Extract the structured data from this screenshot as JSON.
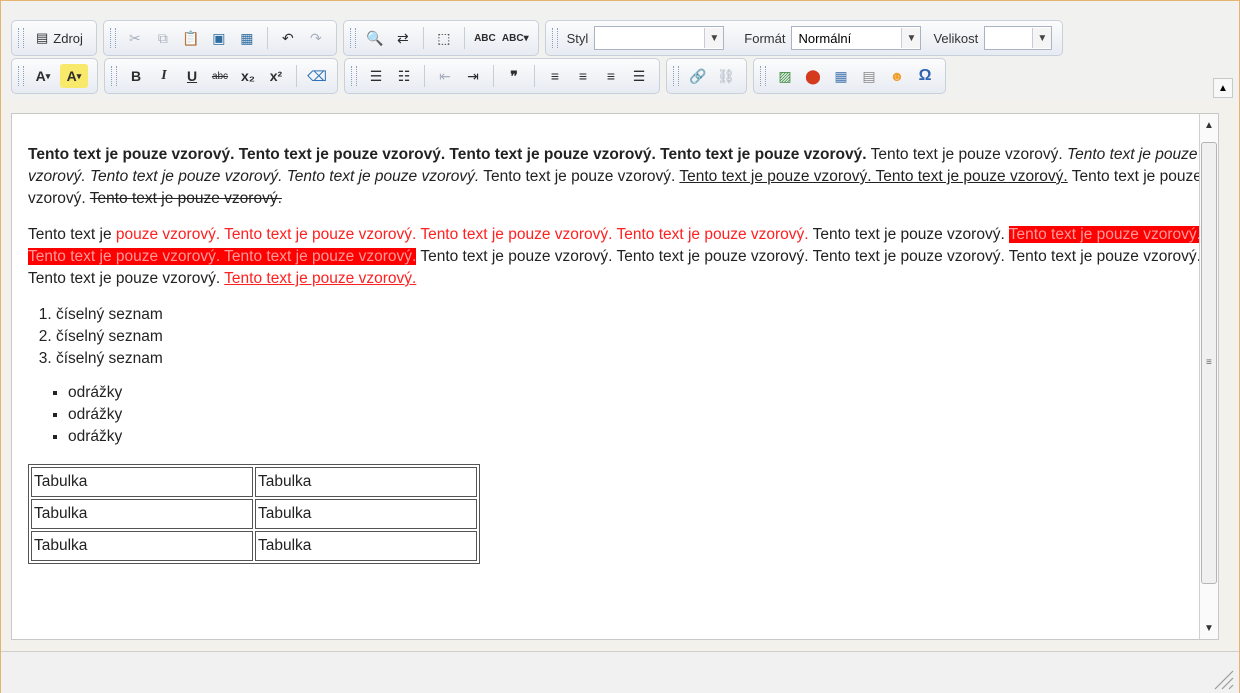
{
  "toolbar": {
    "source_label": "Zdroj",
    "style_label": "Styl",
    "style_value": "",
    "format_label": "Formát",
    "format_value": "Normální",
    "size_label": "Velikost",
    "size_value": "",
    "icons": {
      "bold": "B",
      "italic": "I",
      "underline": "U",
      "strike": "abc",
      "subscript": "x₂",
      "superscript": "x²",
      "spell": "ABC",
      "spell2": "ABC",
      "quote": "❞",
      "omega": "Ω"
    }
  },
  "content": {
    "bold_sentences": "Tento text je pouze vzorový. Tento text je pouze vzorový. Tento text je pouze vzorový. Tento text je pouze vzorový.",
    "plain1": " Tento text je pouze vzorový. ",
    "italic_sentences": "Tento text je pouze vzorový. Tento text je pouze vzorový. Tento text je pouze vzorový.",
    "plain2": " Tento text je pouze vzorový. ",
    "underline_sentences": "Tento text je pouze vzorový. Tento text je pouze vzorový.",
    "plain3": " Tento text je pouze vzorový. ",
    "strike_sentence": "Tento text je pouze vzorový.",
    "p2_start": "Tento text je ",
    "p2_red": "pouze vzorový. Tento text je pouze vzorový. Tento text je pouze vzorový. Tento text je pouze vzorový.",
    "p2_plain1": " Tento text je pouze vzorový. ",
    "p2_redbg": "Tento text je pouze vzorový. Tento text je pouze vzorový. Tento text je pouze vzorový.",
    "p2_plain2": " Tento text je pouze vzorový. Tento text je pouze vzorový. Tento text je pouze vzorový. Tento text je pouze vzorový. Tento text je pouze vzorový. ",
    "p2_redunder": "Tento text je pouze vzorový. ",
    "ordered": [
      "číselný seznam",
      "číselný seznam",
      "číselný seznam"
    ],
    "bullets": [
      "odrážky",
      "odrážky",
      "odrážky"
    ],
    "table": [
      [
        "Tabulka",
        "Tabulka"
      ],
      [
        "Tabulka",
        "Tabulka"
      ],
      [
        "Tabulka",
        "Tabulka"
      ]
    ]
  },
  "colors": {
    "accent_border": "#e6b46f",
    "red": "#ff0000"
  }
}
